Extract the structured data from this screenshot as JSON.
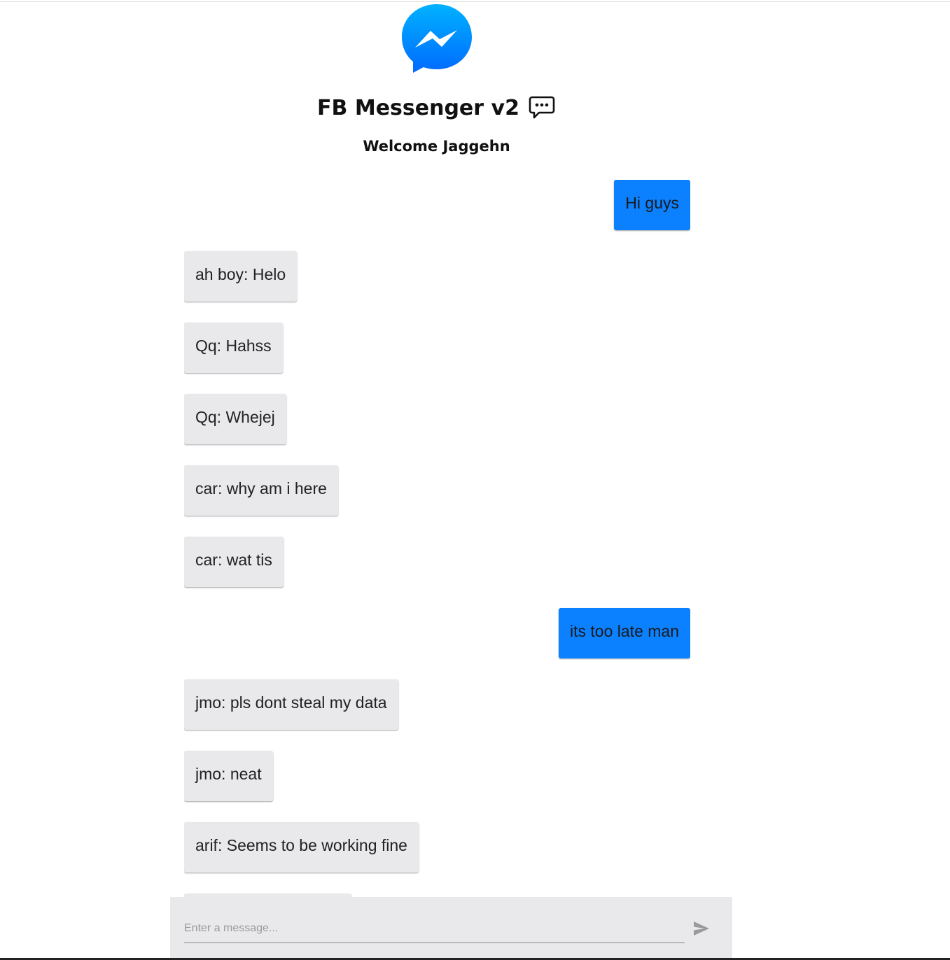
{
  "app": {
    "title": "FB Messenger v2",
    "welcome": "Welcome Jaggehn",
    "logo_icon": "messenger-logo-icon",
    "title_icon": "chat-bubble-icon",
    "accent_color": "#0b81ff",
    "incoming_color": "#e9e9eb"
  },
  "messages": [
    {
      "text": "Hi guys",
      "mine": true
    },
    {
      "text": "ah boy: Helo",
      "mine": false
    },
    {
      "text": "Qq: Hahss",
      "mine": false
    },
    {
      "text": "Qq: Whejej",
      "mine": false
    },
    {
      "text": "car: why am i here",
      "mine": false
    },
    {
      "text": "car: wat tis",
      "mine": false
    },
    {
      "text": "its too late man",
      "mine": true
    },
    {
      "text": "jmo: pls dont steal my data",
      "mine": false
    },
    {
      "text": "jmo: neat",
      "mine": false
    },
    {
      "text": "arif: Seems to be working fine",
      "mine": false
    }
  ],
  "composer": {
    "placeholder": "Enter a message...",
    "value": "",
    "send_icon": "send-icon"
  }
}
